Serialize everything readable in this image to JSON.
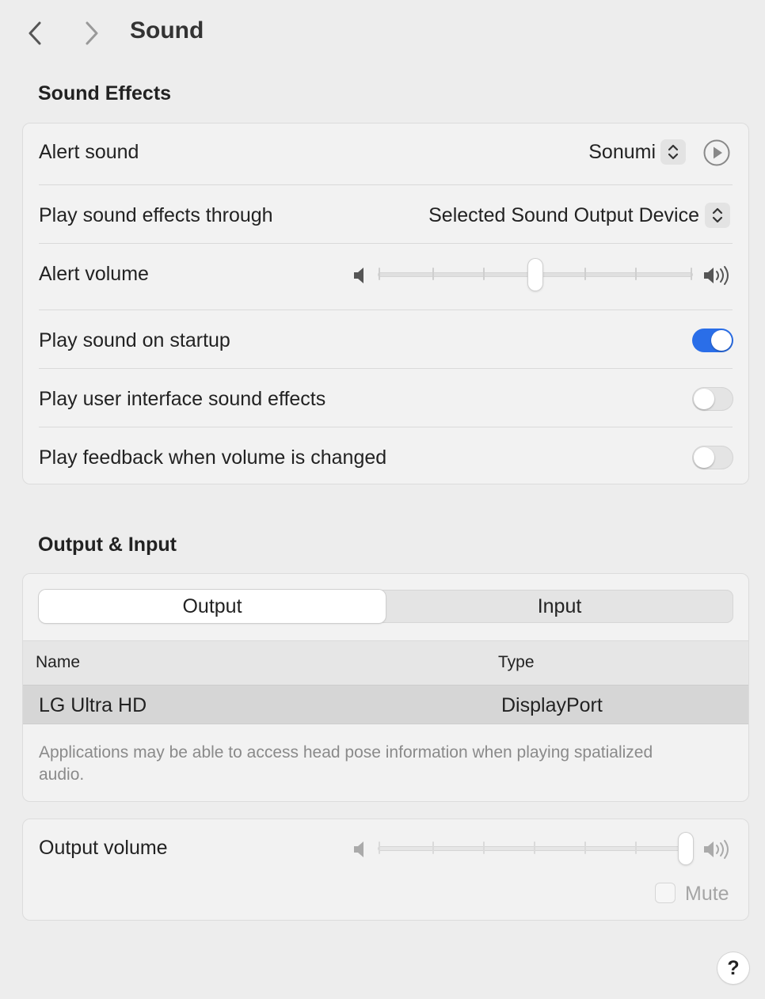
{
  "header": {
    "title": "Sound",
    "back_icon": "chevron-left-icon",
    "forward_icon": "chevron-right-icon"
  },
  "sound_effects": {
    "section_title": "Sound Effects",
    "alert_sound": {
      "label": "Alert sound",
      "value": "Sonumi"
    },
    "play_through": {
      "label": "Play sound effects through",
      "value": "Selected Sound Output Device"
    },
    "alert_volume": {
      "label": "Alert volume",
      "level": 0.5
    },
    "startup": {
      "label": "Play sound on startup",
      "enabled": true
    },
    "ui_effects": {
      "label": "Play user interface sound effects",
      "enabled": false
    },
    "feedback": {
      "label": "Play feedback when volume is changed",
      "enabled": false
    }
  },
  "output_input": {
    "section_title": "Output & Input",
    "tabs": [
      {
        "label": "Output",
        "selected": true
      },
      {
        "label": "Input",
        "selected": false
      }
    ],
    "columns": [
      "Name",
      "Type"
    ],
    "rows": [
      {
        "name": "LG Ultra HD",
        "type": "DisplayPort"
      }
    ],
    "note": "Applications may be able to access head pose information when playing spatialized audio."
  },
  "output_volume": {
    "label": "Output volume",
    "level": 1.0,
    "mute_label": "Mute",
    "muted": false
  },
  "help": {
    "label": "?"
  },
  "colors": {
    "accent": "#2a6ee8"
  }
}
